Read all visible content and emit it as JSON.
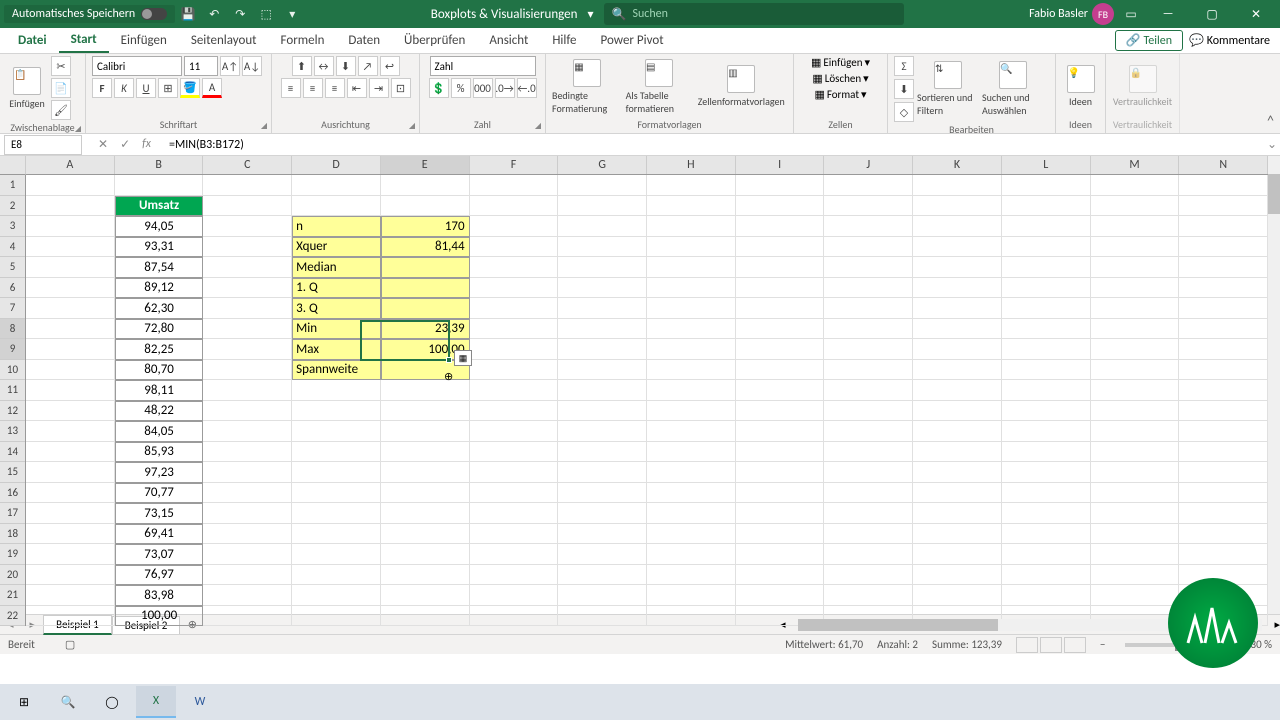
{
  "titlebar": {
    "autosave": "Automatisches Speichern",
    "doc_name": "Boxplots & Visualisierungen",
    "search_placeholder": "Suchen",
    "user_name": "Fabio Basler",
    "user_initials": "FB"
  },
  "tabs": {
    "datei": "Datei",
    "start": "Start",
    "einfuegen": "Einfügen",
    "seitenlayout": "Seitenlayout",
    "formeln": "Formeln",
    "daten": "Daten",
    "ueberpruefen": "Überprüfen",
    "ansicht": "Ansicht",
    "hilfe": "Hilfe",
    "powerpivot": "Power Pivot",
    "teilen": "Teilen",
    "kommentare": "Kommentare"
  },
  "ribbon": {
    "zwischenablage": "Zwischenablage",
    "einfuegen": "Einfügen",
    "schriftart": "Schriftart",
    "font_name": "Calibri",
    "font_size": "11",
    "ausrichtung": "Ausrichtung",
    "zahl": "Zahl",
    "number_format": "Zahl",
    "formatvorlagen": "Formatvorlagen",
    "bedingte": "Bedingte Formatierung",
    "als_tabelle": "Als Tabelle formatieren",
    "zellen_fv": "Zellenformatvorlagen",
    "zellen": "Zellen",
    "zellen_einfuegen": "Einfügen",
    "zellen_loeschen": "Löschen",
    "zellen_format": "Format",
    "bearbeiten": "Bearbeiten",
    "sortieren": "Sortieren und Filtern",
    "suchen": "Suchen und Auswählen",
    "ideen_grp": "Ideen",
    "ideen": "Ideen",
    "vertraulichkeit_grp": "Vertraulichkeit",
    "vertraulichkeit": "Vertraulichkeit"
  },
  "fbar": {
    "name_box": "E8",
    "formula": "=MIN(B3:B172)"
  },
  "columns": [
    "A",
    "B",
    "C",
    "D",
    "E",
    "F",
    "G",
    "H",
    "I",
    "J",
    "K",
    "L",
    "M",
    "N"
  ],
  "col_b_header": "Umsatz",
  "col_b": [
    "94,05",
    "93,31",
    "87,54",
    "89,12",
    "62,30",
    "72,80",
    "82,25",
    "80,70",
    "98,11",
    "48,22",
    "84,05",
    "85,93",
    "97,23",
    "70,77",
    "73,15",
    "69,41",
    "73,07",
    "76,97",
    "83,98",
    "100,00"
  ],
  "stats": {
    "labels": [
      "n",
      "Xquer",
      "Median",
      "1. Q",
      "3. Q",
      "Min",
      "Max",
      "Spannweite"
    ],
    "values": [
      "170",
      "81,44",
      "",
      "",
      "",
      "23,39",
      "100,00",
      ""
    ]
  },
  "sheets": {
    "s1": "Beispiel 1",
    "s2": "Beispiel 2"
  },
  "status": {
    "ready": "Bereit",
    "mittelwert": "Mittelwert: 61,70",
    "anzahl": "Anzahl: 2",
    "summe": "Summe: 123,39",
    "zoom": "130 %"
  }
}
